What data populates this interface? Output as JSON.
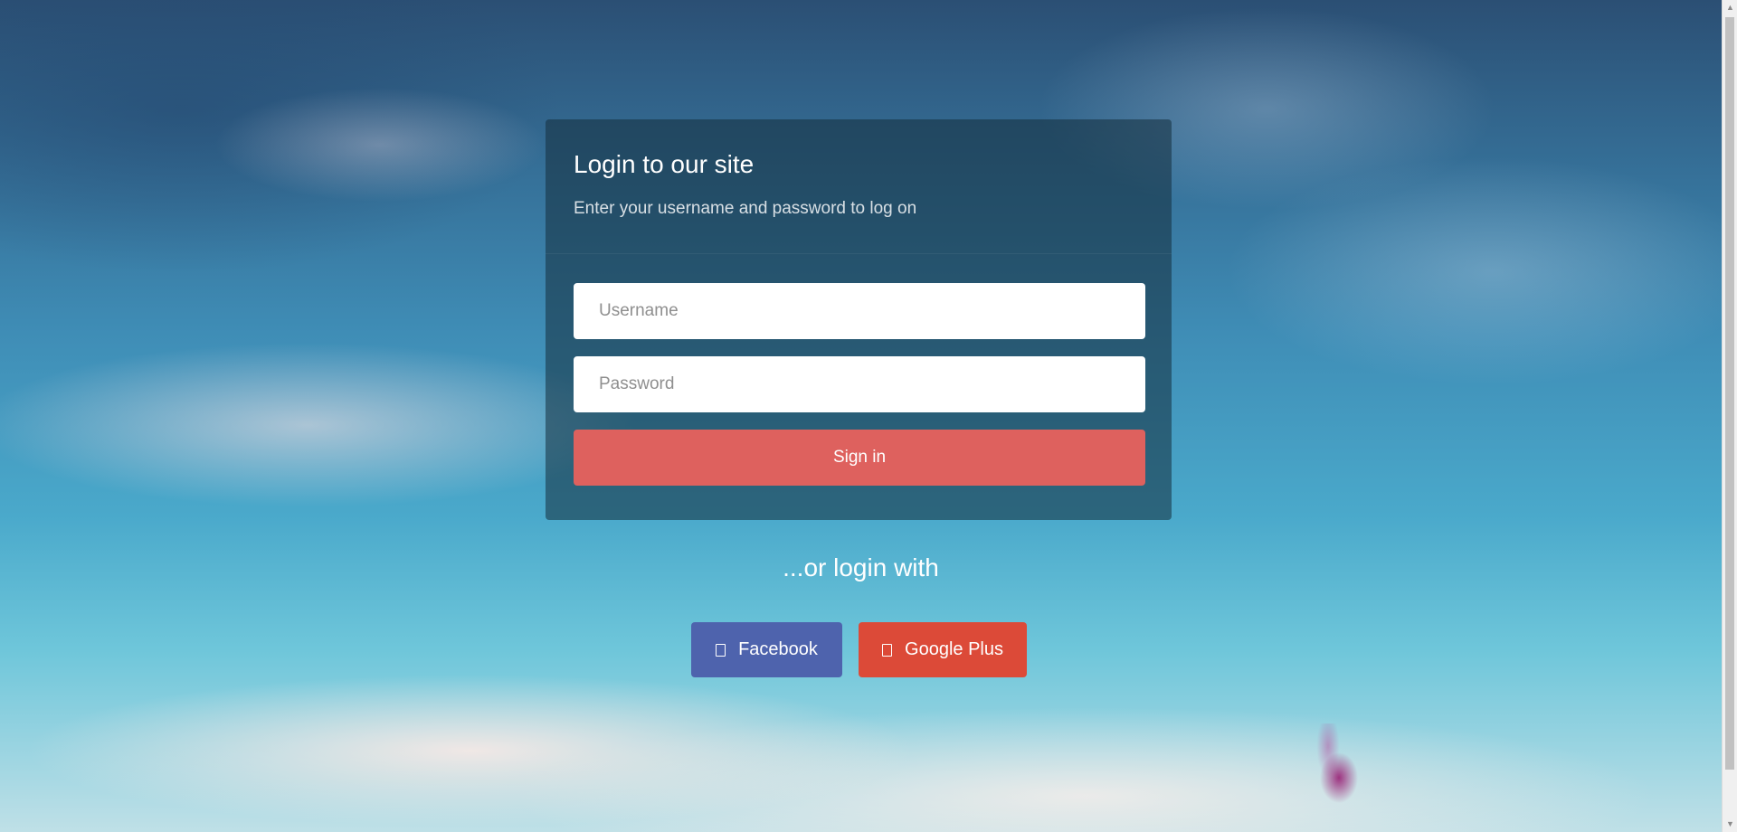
{
  "background": {
    "image": "sky-with-clouds",
    "colors": {
      "sky_top": "#2b4f74",
      "sky_bottom": "#bfe0e7"
    }
  },
  "login_card": {
    "title": "Login to our site",
    "subtitle": "Enter your username and password to log on",
    "username": {
      "value": "",
      "placeholder": "Username"
    },
    "password": {
      "value": "",
      "placeholder": "Password"
    },
    "signin_label": "Sign in",
    "colors": {
      "panel": "rgba(20,45,60,0.55)",
      "signin_button": "#de615e"
    }
  },
  "social": {
    "heading": "...or login with",
    "facebook": {
      "label": "Facebook",
      "icon": "facebook-icon",
      "color": "#4e63ad"
    },
    "google": {
      "label": "Google Plus",
      "icon": "google-plus-icon",
      "color": "#dc4a38"
    }
  },
  "scrollbar": {
    "up_arrow": "▲",
    "down_arrow": "▼"
  }
}
